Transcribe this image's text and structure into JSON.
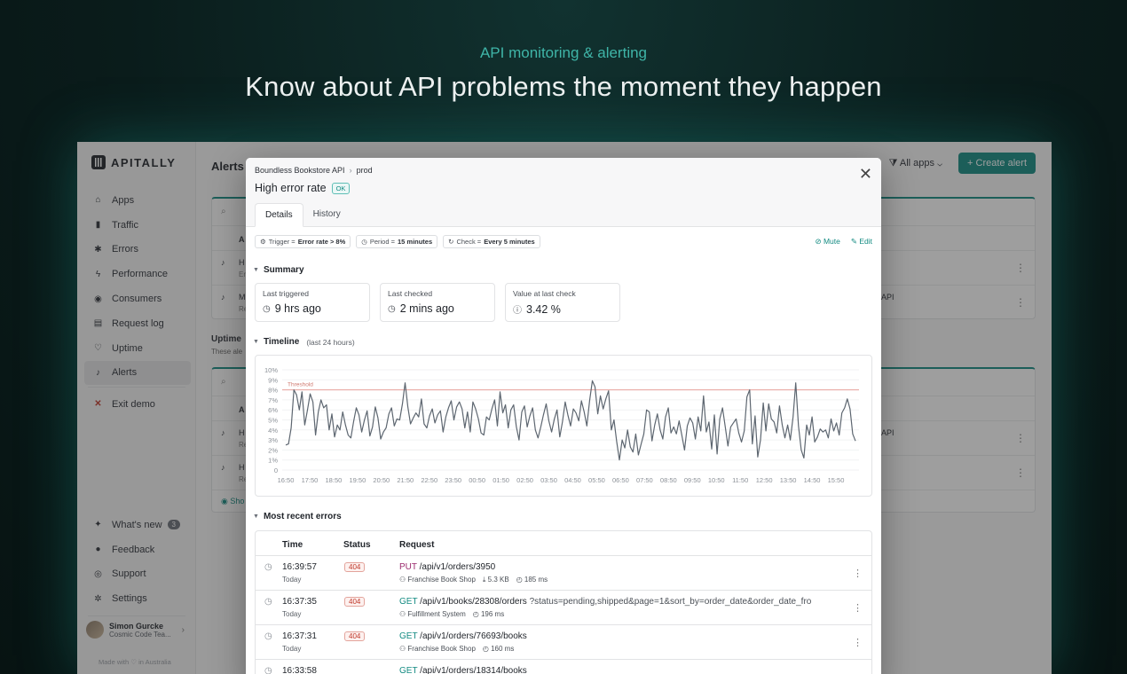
{
  "hero": {
    "eyebrow": "API monitoring & alerting",
    "title": "Know about API problems the moment they happen"
  },
  "sidebar": {
    "logo": "APITALLY",
    "items": [
      {
        "label": "Apps",
        "icon": "home-icon"
      },
      {
        "label": "Traffic",
        "icon": "bar-chart-icon"
      },
      {
        "label": "Errors",
        "icon": "bug-icon"
      },
      {
        "label": "Performance",
        "icon": "bolt-icon"
      },
      {
        "label": "Consumers",
        "icon": "users-icon"
      },
      {
        "label": "Request log",
        "icon": "log-icon"
      },
      {
        "label": "Uptime",
        "icon": "heartbeat-icon"
      },
      {
        "label": "Alerts",
        "icon": "bell-icon"
      }
    ],
    "exit_label": "Exit demo",
    "bottom_items": [
      {
        "label": "What's new",
        "badge": "3"
      },
      {
        "label": "Feedback"
      },
      {
        "label": "Support"
      },
      {
        "label": "Settings"
      }
    ],
    "user": {
      "name": "Simon Gurcke",
      "team": "Cosmic Code Tea..."
    },
    "made_with": "Made with ♡ in Australia"
  },
  "main": {
    "title": "Alerts",
    "filter_label": "All apps",
    "create_label": "+ Create alert",
    "uptime_heading": "Uptime",
    "uptime_sub": "These ale",
    "col_a": "A",
    "rows_left": [
      "H",
      "M",
      "H",
      "H"
    ],
    "rows_left_sub": [
      "Er",
      "Re",
      "Re",
      "Re"
    ],
    "rows_right": [
      "API",
      "API"
    ],
    "show_label": "Sho"
  },
  "modal": {
    "breadcrumb_app": "Boundless Bookstore API",
    "breadcrumb_env": "prod",
    "title": "High error rate",
    "status": "OK",
    "tabs": [
      "Details",
      "History"
    ],
    "pills": [
      {
        "label": "Trigger =",
        "value": "Error rate > 8%"
      },
      {
        "label": "Period =",
        "value": "15 minutes"
      },
      {
        "label": "Check =",
        "value": "Every 5 minutes"
      }
    ],
    "mute_label": "Mute",
    "edit_label": "Edit",
    "summary_heading": "Summary",
    "stats": [
      {
        "label": "Last triggered",
        "value": "9 hrs ago"
      },
      {
        "label": "Last checked",
        "value": "2 mins ago"
      },
      {
        "label": "Value at last check",
        "value": "3.42 %"
      }
    ],
    "timeline_heading": "Timeline",
    "timeline_sub": "(last 24 hours)",
    "errors_heading": "Most recent errors",
    "errors_columns": [
      "Time",
      "Status",
      "Request"
    ],
    "errors": [
      {
        "time": "16:39:57",
        "day": "Today",
        "status": "404",
        "method": "PUT",
        "path": "/api/v1/orders/3950",
        "query": "",
        "consumer": "Franchise Book Shop",
        "size": "5.3 KB",
        "duration": "185 ms"
      },
      {
        "time": "16:37:35",
        "day": "Today",
        "status": "404",
        "method": "GET",
        "path": "/api/v1/books/28308/orders",
        "query": "?status=pending,shipped&page=1&sort_by=order_date&order_date_fro",
        "consumer": "Fulfillment System",
        "size": "",
        "duration": "196 ms"
      },
      {
        "time": "16:37:31",
        "day": "Today",
        "status": "404",
        "method": "GET",
        "path": "/api/v1/orders/76693/books",
        "query": "",
        "consumer": "Franchise Book Shop",
        "size": "",
        "duration": "160 ms"
      },
      {
        "time": "16:33:58",
        "day": "",
        "status": "",
        "method": "GET",
        "path": "/api/v1/orders/18314/books",
        "query": "",
        "consumer": "",
        "size": "",
        "duration": ""
      }
    ]
  },
  "chart_data": {
    "type": "line",
    "title": "",
    "xlabel": "",
    "ylabel": "",
    "ylim": [
      0,
      10
    ],
    "yticks": [
      "0",
      "1%",
      "2%",
      "3%",
      "4%",
      "5%",
      "6%",
      "7%",
      "8%",
      "9%",
      "10%"
    ],
    "xticks": [
      "16:50",
      "17:50",
      "18:50",
      "19:50",
      "20:50",
      "21:50",
      "22:50",
      "23:50",
      "00:50",
      "01:50",
      "02:50",
      "03:50",
      "04:50",
      "05:50",
      "06:50",
      "07:50",
      "08:50",
      "09:50",
      "10:50",
      "11:50",
      "12:50",
      "13:50",
      "14:50",
      "15:50"
    ],
    "threshold": {
      "value": 8,
      "label": "Threshold"
    },
    "line_color": "#5d6670",
    "threshold_color": "#e8a19a",
    "series": [
      {
        "values": [
          2.5,
          2.6,
          4.2,
          8,
          7.5,
          6,
          7.8,
          4.5,
          6,
          7.6,
          6.8,
          3.5,
          5.8,
          7,
          6.2,
          6.5,
          4,
          5.6,
          3.3,
          4.5,
          4,
          5.8,
          4.5,
          3.5,
          3.2,
          4.8,
          6.2,
          5.5,
          3.8,
          5,
          5.9,
          3.4,
          4.3,
          6.3,
          5.2,
          3.1,
          3.8,
          4.2,
          5.6,
          6.2,
          4.4,
          5.1,
          5,
          6.6,
          8.7,
          6.3,
          4.6,
          5.2,
          5.7,
          5.3,
          7.1,
          4.6,
          4.2,
          5.4,
          6.1,
          4.7,
          5.5,
          5.9,
          3.8,
          5.3,
          6.2,
          6.9,
          5,
          6.3,
          6.8,
          6.1,
          4.2,
          5.8,
          3.8,
          6.8,
          6.1,
          5.1,
          3.7,
          3.5,
          5.3,
          5,
          6.1,
          7,
          4.4,
          7.8,
          5.7,
          6.5,
          4.2,
          6,
          6.5,
          4.3,
          3,
          5.8,
          6.4,
          4.3,
          5.4,
          6.2,
          4,
          3.2,
          4.3,
          5.5,
          6.6,
          4.9,
          3.8,
          5.1,
          6,
          3.3,
          4.8,
          6.8,
          5.5,
          4.4,
          6.1,
          5.7,
          4.9,
          6.9,
          5.8,
          4.4,
          6.9,
          8.9,
          8.3,
          5.6,
          7.4,
          6.1,
          7.1,
          7.9,
          4,
          5,
          2.8,
          1,
          3,
          2.2,
          4,
          2.3,
          1.8,
          3.6,
          1.5,
          2.6,
          3.6,
          6,
          5.8,
          2.9,
          4.5,
          5.6,
          4,
          3.1,
          5.3,
          6.2,
          3.7,
          4.3,
          3.6,
          4.9,
          3.5,
          2,
          4.4,
          5.2,
          4.7,
          3.1,
          5.3,
          3.9,
          7.4,
          3.8,
          4.8,
          2.1,
          5.5,
          1.6,
          5.1,
          6.2,
          4.3,
          2.4,
          4.3,
          4.7,
          5.1,
          3.7,
          2.8,
          3.9,
          7.3,
          8,
          2.6,
          5.4,
          1.3,
          3,
          6.7,
          3.9,
          6.6,
          5.1,
          4.8,
          3.7,
          6.4,
          4.5,
          3.2,
          4.5,
          3,
          5.3,
          8.7,
          4.4,
          2,
          1.2,
          4.5,
          3.5,
          5.3,
          2.8,
          3.3,
          4.1,
          3.8,
          4,
          3.2,
          5.1,
          3.9,
          4.7,
          3.5,
          5.7,
          6.2,
          7.1,
          6.1,
          3.6,
          2.9
        ]
      }
    ]
  }
}
